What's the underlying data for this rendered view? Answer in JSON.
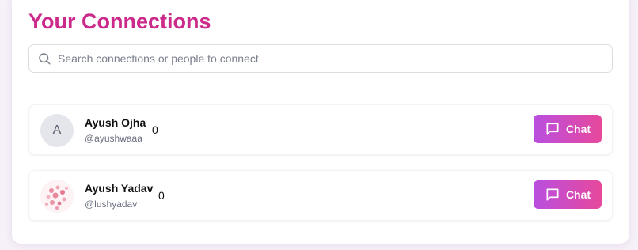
{
  "header": {
    "title": "Your Connections"
  },
  "search": {
    "placeholder": "Search connections or people to connect",
    "icon": "search-icon"
  },
  "connections": [
    {
      "avatar_letter": "A",
      "avatar_type": "initial",
      "name": "Ayush Ojha",
      "username": "@ayushwaaa",
      "count": "0",
      "chat_label": "Chat"
    },
    {
      "avatar_type": "image",
      "name": "Ayush Yadav",
      "username": "@lushyadav",
      "count": "0",
      "chat_label": "Chat"
    }
  ],
  "colors": {
    "title": "#cc2a8a",
    "button_gradient_start": "#b94fe0",
    "button_gradient_end": "#e7489c"
  }
}
